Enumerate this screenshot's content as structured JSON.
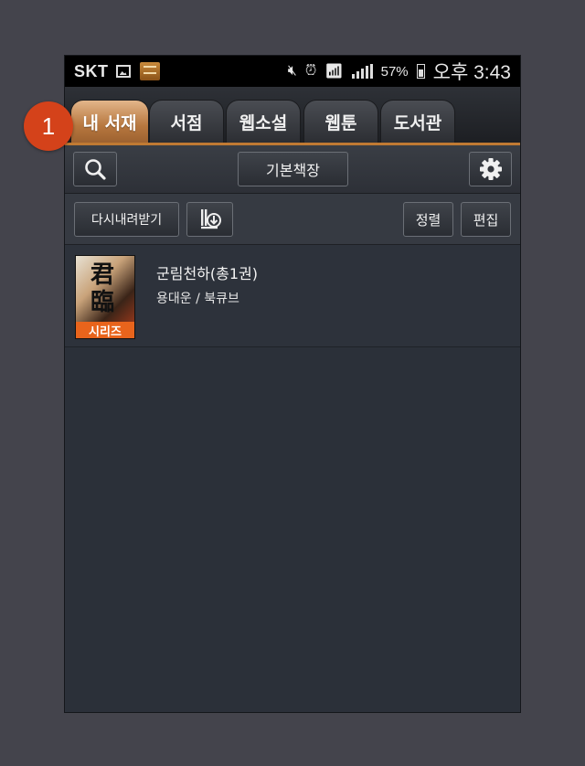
{
  "status": {
    "carrier": "SKT",
    "battery": "57%",
    "time": "오후 3:43"
  },
  "badge": "1",
  "tabs": [
    {
      "label": "내 서재",
      "active": true
    },
    {
      "label": "서점",
      "active": false
    },
    {
      "label": "웹소설",
      "active": false
    },
    {
      "label": "웹툰",
      "active": false
    },
    {
      "label": "도서관",
      "active": false
    }
  ],
  "toolbar": {
    "search_icon": "search-icon",
    "shelf_label": "기본책장",
    "settings_icon": "gear-icon"
  },
  "subbar": {
    "redownload_label": "다시내려받기",
    "download_icon": "book-download-icon",
    "sort_label": "정렬",
    "edit_label": "편집"
  },
  "books": [
    {
      "title": "군림천하(총1권)",
      "author_publisher": "용대운 / 북큐브",
      "cover_tag": "시리즈"
    }
  ],
  "colors": {
    "accent": "#c07a33",
    "badge": "#d4421a",
    "cover_tag": "#e8641c",
    "background": "#2b3039"
  }
}
